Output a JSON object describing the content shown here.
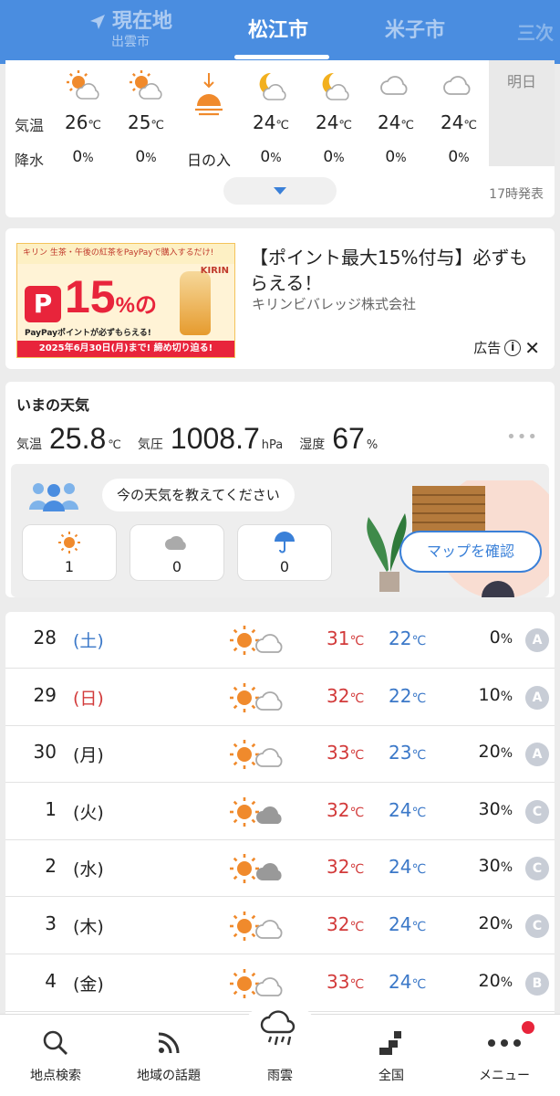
{
  "header": {
    "current_location_label": "現在地",
    "current_location_sub": "出雲市",
    "tabs": [
      {
        "label": "松江市",
        "active": true
      },
      {
        "label": "米子市",
        "active": false
      },
      {
        "label": "三次",
        "active": false
      }
    ]
  },
  "hourly": {
    "row_labels": {
      "temp": "気温",
      "rain": "降水"
    },
    "columns": [
      {
        "icon": "sun-cloud-icon",
        "temp": "26",
        "temp_unit": "℃",
        "rain": "0",
        "rain_unit": "%"
      },
      {
        "icon": "sun-cloud-icon",
        "temp": "25",
        "temp_unit": "℃",
        "rain": "0",
        "rain_unit": "%"
      },
      {
        "icon": "sunset-icon",
        "event": "日の入"
      },
      {
        "icon": "moon-cloud-icon",
        "temp": "24",
        "temp_unit": "℃",
        "rain": "0",
        "rain_unit": "%"
      },
      {
        "icon": "moon-cloud-icon",
        "temp": "24",
        "temp_unit": "℃",
        "rain": "0",
        "rain_unit": "%"
      },
      {
        "icon": "cloud-icon",
        "temp": "24",
        "temp_unit": "℃",
        "rain": "0",
        "rain_unit": "%"
      },
      {
        "icon": "cloud-icon",
        "temp": "24",
        "temp_unit": "℃",
        "rain": "0",
        "rain_unit": "%"
      }
    ],
    "tomorrow_label": "明日",
    "issued": "17時発表"
  },
  "ad": {
    "banner": {
      "top_text": "キリン 生茶・午後の紅茶をPayPayで購入するだけ!",
      "big_number": "15",
      "big_suffix": "%の",
      "pp_logo": "P",
      "points_text": "PayPayポイントが必ずもらえる!",
      "deadline": "2025年6月30日(月)まで! 締め切り迫る!",
      "brand": "KIRIN"
    },
    "title": "【ポイント最大15%付与】必ずもらえる！",
    "company": "キリンビバレッジ株式会社",
    "tag": "広告"
  },
  "now": {
    "title": "いまの天気",
    "temp_label": "気温",
    "temp_value": "25.8",
    "temp_unit": "℃",
    "pressure_label": "気圧",
    "pressure_value": "1008.7",
    "pressure_unit": "hPa",
    "humidity_label": "湿度",
    "humidity_value": "67",
    "humidity_unit": "%",
    "more": "•••",
    "prompt": "今の天気を教えてください",
    "votes": [
      {
        "icon": "sun-icon",
        "count": "1"
      },
      {
        "icon": "cloud-icon",
        "count": "0"
      },
      {
        "icon": "umbrella-icon",
        "count": "0"
      }
    ],
    "map_button": "マップを確認"
  },
  "weekly": [
    {
      "day": "28",
      "dow": "(土)",
      "dow_type": "sat",
      "icon": "sun-cloud",
      "hi": "31",
      "lo": "22",
      "unit": "℃",
      "rain": "0",
      "rain_unit": "%",
      "rel": "A"
    },
    {
      "day": "29",
      "dow": "(日)",
      "dow_type": "sun",
      "icon": "sun-cloud",
      "hi": "32",
      "lo": "22",
      "unit": "℃",
      "rain": "10",
      "rain_unit": "%",
      "rel": "A"
    },
    {
      "day": "30",
      "dow": "(月)",
      "dow_type": "week",
      "icon": "sun-cloud",
      "hi": "33",
      "lo": "23",
      "unit": "℃",
      "rain": "20",
      "rain_unit": "%",
      "rel": "A"
    },
    {
      "day": "1",
      "dow": "(火)",
      "dow_type": "week",
      "icon": "sun-cloudy",
      "hi": "32",
      "lo": "24",
      "unit": "℃",
      "rain": "30",
      "rain_unit": "%",
      "rel": "C"
    },
    {
      "day": "2",
      "dow": "(水)",
      "dow_type": "week",
      "icon": "sun-cloudy",
      "hi": "32",
      "lo": "24",
      "unit": "℃",
      "rain": "30",
      "rain_unit": "%",
      "rel": "C"
    },
    {
      "day": "3",
      "dow": "(木)",
      "dow_type": "week",
      "icon": "sun-cloud",
      "hi": "32",
      "lo": "24",
      "unit": "℃",
      "rain": "20",
      "rain_unit": "%",
      "rel": "C"
    },
    {
      "day": "4",
      "dow": "(金)",
      "dow_type": "week",
      "icon": "sun-cloud",
      "hi": "33",
      "lo": "24",
      "unit": "℃",
      "rain": "20",
      "rain_unit": "%",
      "rel": "B"
    }
  ],
  "nav": [
    {
      "label": "地点検索",
      "icon": "search-icon"
    },
    {
      "label": "地域の話題",
      "icon": "feed-icon"
    },
    {
      "label": "雨雲",
      "icon": "rain-cloud-icon"
    },
    {
      "label": "全国",
      "icon": "map-icon"
    },
    {
      "label": "メニュー",
      "icon": "more-icon"
    }
  ],
  "colors": {
    "header": "#4a8de0",
    "accent": "#3a80d8",
    "high_temp": "#d23a3a",
    "low_temp": "#3b78c8",
    "sun": "#f08a2c"
  }
}
